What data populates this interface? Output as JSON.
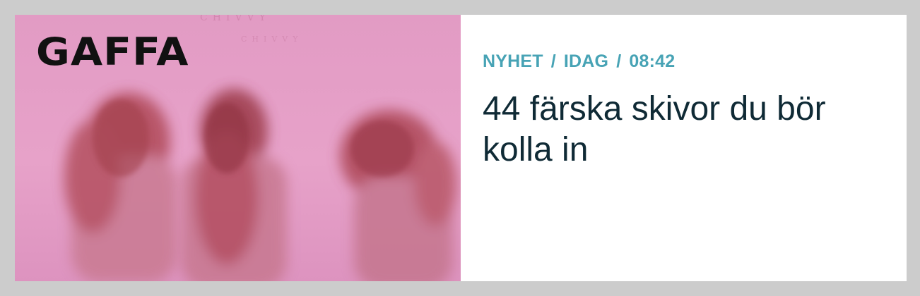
{
  "logo": {
    "text": "GAFFA"
  },
  "image": {
    "faint_text_top": "CHIVVY",
    "faint_text_second": "CHIVVY",
    "description_icon": "band-photo-icon"
  },
  "article": {
    "category": "NYHET",
    "date": "IDAG",
    "time": "08:42",
    "separator": "/",
    "headline": "44 färska skivor du bör kolla in"
  },
  "colors": {
    "meta": "#47a3b5",
    "headline": "#0f2a35",
    "image_bg": "#e29bc4",
    "page_bg": "#cccccc"
  }
}
